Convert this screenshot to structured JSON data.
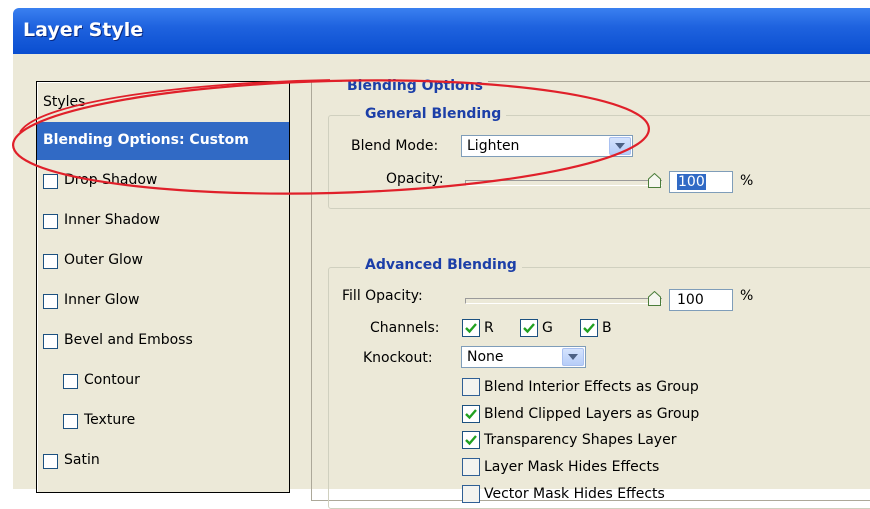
{
  "window": {
    "title": "Layer Style"
  },
  "styles_list": {
    "header": "Styles",
    "selected": "Blending Options: Custom",
    "items": [
      {
        "label": "Drop Shadow",
        "checked": false,
        "indent": 0
      },
      {
        "label": "Inner Shadow",
        "checked": false,
        "indent": 0
      },
      {
        "label": "Outer Glow",
        "checked": false,
        "indent": 0
      },
      {
        "label": "Inner Glow",
        "checked": false,
        "indent": 0
      },
      {
        "label": "Bevel and Emboss",
        "checked": false,
        "indent": 0
      },
      {
        "label": "Contour",
        "checked": false,
        "indent": 1
      },
      {
        "label": "Texture",
        "checked": false,
        "indent": 1
      },
      {
        "label": "Satin",
        "checked": false,
        "indent": 0
      }
    ]
  },
  "blending": {
    "title": "Blending Options",
    "general": {
      "title": "General Blending",
      "blend_mode_label": "Blend Mode:",
      "blend_mode_value": "Lighten",
      "opacity_label": "Opacity:",
      "opacity_value": "100",
      "opacity_level": 100,
      "percent": "%"
    },
    "advanced": {
      "title": "Advanced Blending",
      "fill_opacity_label": "Fill Opacity:",
      "fill_opacity_value": "100",
      "fill_opacity_level": 100,
      "percent": "%",
      "channels_label": "Channels:",
      "channels": [
        {
          "label": "R",
          "checked": true
        },
        {
          "label": "G",
          "checked": true
        },
        {
          "label": "B",
          "checked": true
        }
      ],
      "knockout_label": "Knockout:",
      "knockout_value": "None",
      "options": [
        {
          "label": "Blend Interior Effects as Group",
          "checked": false
        },
        {
          "label": "Blend Clipped Layers as Group",
          "checked": true
        },
        {
          "label": "Transparency Shapes Layer",
          "checked": true
        },
        {
          "label": "Layer Mask Hides Effects",
          "checked": false
        },
        {
          "label": "Vector Mask Hides Effects",
          "checked": false
        }
      ]
    }
  },
  "annotation": {
    "shape": "red-ellipse",
    "color": "#e0202a"
  },
  "colors": {
    "title_bar": "#1f63df",
    "selection": "#316ac5",
    "section_title": "#1c3fa8",
    "dialog_bg": "#ece9d8",
    "check": "#21a121"
  }
}
